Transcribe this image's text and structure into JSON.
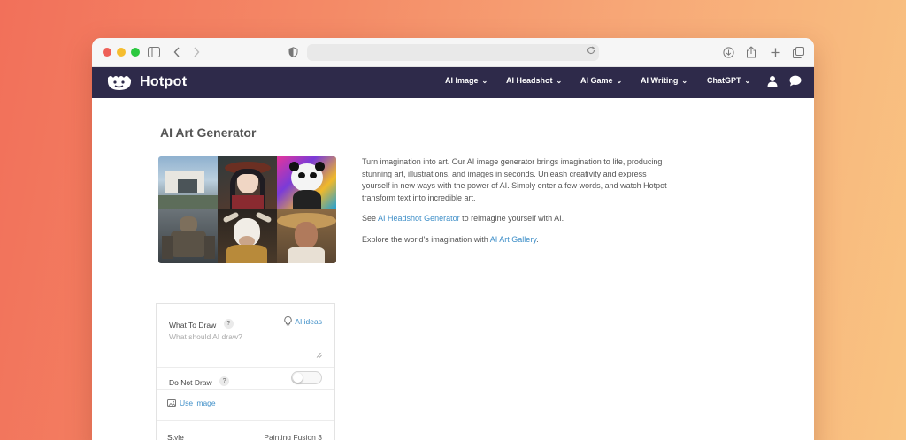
{
  "brand": {
    "name": "Hotpot"
  },
  "nav": {
    "items": [
      {
        "label": "AI Image"
      },
      {
        "label": "AI Headshot"
      },
      {
        "label": "AI Game"
      },
      {
        "label": "AI Writing"
      },
      {
        "label": "ChatGPT"
      }
    ],
    "account_icon": "user-icon",
    "chat_icon": "chat-bubble-icon"
  },
  "page": {
    "title": "AI Art Generator",
    "description": "Turn imagination into art. Our AI image generator brings imagination to life, producing stunning art, illustrations, and images in seconds. Unleash creativity and express yourself in new ways with the power of AI. Simply enter a few words, and watch Hotpot transform text into incredible art.",
    "headshot_prefix": "See ",
    "headshot_link": "AI Headshot Generator",
    "headshot_suffix": " to reimagine yourself with AI.",
    "gallery_prefix": "Explore the world's imagination with ",
    "gallery_link": "AI Art Gallery",
    "gallery_suffix": "."
  },
  "form": {
    "what_to_draw_label": "What To Draw",
    "help_mark": "?",
    "ai_ideas_label": "AI ideas",
    "prompt_placeholder": "What should AI draw?",
    "do_not_draw_label": "Do Not Draw",
    "do_not_draw_enabled": false,
    "use_image_label": "Use image",
    "style_label": "Style",
    "style_value": "Painting Fusion 3"
  },
  "colors": {
    "navbar": "#2e2a4a",
    "link": "#3f8fc8",
    "traffic_red": "#ee5f57",
    "traffic_yellow": "#f5bd2f",
    "traffic_green": "#2bc83f"
  }
}
